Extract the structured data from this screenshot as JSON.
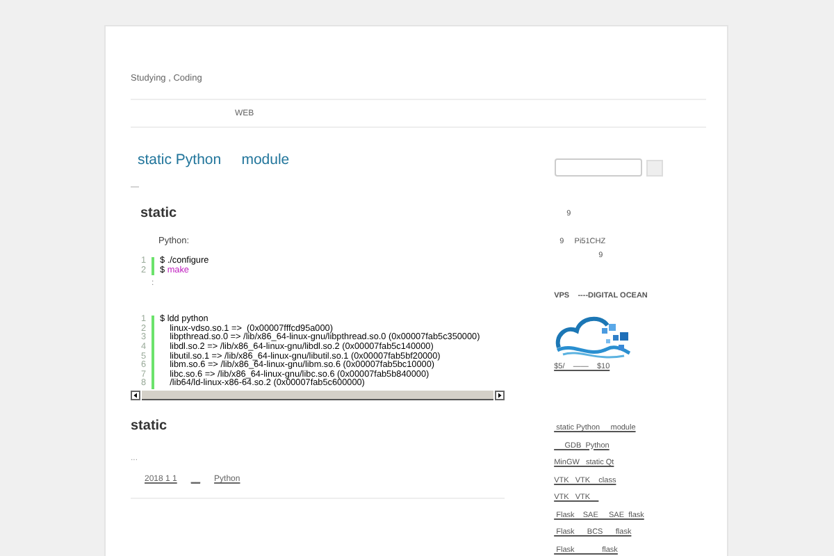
{
  "site": {
    "tagline": "Studying , Coding"
  },
  "nav": {
    "items": [
      {
        "label": "WEB"
      }
    ]
  },
  "post": {
    "title": "static Python     module",
    "separator": "—",
    "heading": "static",
    "intro": "Python:",
    "code_blocks": [
      {
        "lines": [
          {
            "n": "1",
            "tokens": [
              {
                "text": "$ ./configure",
                "kind": "plain"
              }
            ]
          },
          {
            "n": "2",
            "tokens": [
              {
                "text": "$ ",
                "kind": "plain"
              },
              {
                "text": "make",
                "kind": "keyword"
              }
            ]
          }
        ]
      },
      {
        "lines": [
          {
            "n": "1",
            "tokens": [
              {
                "text": "$ ldd python",
                "kind": "plain"
              }
            ]
          },
          {
            "n": "2",
            "tokens": [
              {
                "text": "    linux-vdso.so.1 =>  (0x00007fffcd95a000)",
                "kind": "plain"
              }
            ]
          },
          {
            "n": "3",
            "tokens": [
              {
                "text": "    libpthread.so.0 => /lib/x86_64-linux-gnu/libpthread.so.0 (0x00007fab5c350000)",
                "kind": "plain"
              }
            ]
          },
          {
            "n": "4",
            "tokens": [
              {
                "text": "    libdl.so.2 => /lib/x86_64-linux-gnu/libdl.so.2 (0x00007fab5c140000)",
                "kind": "plain"
              }
            ]
          },
          {
            "n": "5",
            "tokens": [
              {
                "text": "    libutil.so.1 => /lib/x86_64-linux-gnu/libutil.so.1 (0x00007fab5bf20000)",
                "kind": "plain"
              }
            ]
          },
          {
            "n": "6",
            "tokens": [
              {
                "text": "    libm.so.6 => /lib/x86_64-linux-gnu/libm.so.6 (0x00007fab5bc10000)",
                "kind": "plain"
              }
            ]
          },
          {
            "n": "7",
            "tokens": [
              {
                "text": "    libc.so.6 => /lib/x86_64-linux-gnu/libc.so.6 (0x00007fab5b840000)",
                "kind": "plain"
              }
            ]
          },
          {
            "n": "8",
            "tokens": [
              {
                "text": "    /lib64/ld-linux-x86-64.so.2 (0x00007fab5c600000)",
                "kind": "plain"
              }
            ]
          }
        ]
      }
    ],
    "between": ":"
  },
  "next_post": {
    "heading": "static",
    "excerpt": "...",
    "meta": [
      {
        "text": "2018 1 1"
      },
      {
        "text": "__"
      },
      {
        "text": "Python"
      }
    ]
  },
  "sidebar": {
    "notes": [
      {
        "text": "9"
      },
      {
        "text": "9     Pi51CHZ"
      },
      {
        "text": "9"
      }
    ],
    "ad_title": "VPS    ----DIGITAL OCEAN",
    "ad_prices": "$5/    ——    $10",
    "links": [
      {
        "text": " static Python     module"
      },
      {
        "text": "     GDB  Python"
      },
      {
        "text": "MinGW   static Qt"
      },
      {
        "text": "VTK   VTK    class"
      },
      {
        "text": "VTK   VTK    "
      },
      {
        "text": " Flask    SAE     SAE  flask"
      },
      {
        "text": " Flask      BCS      flask"
      },
      {
        "text": " Flask             flask"
      }
    ]
  }
}
